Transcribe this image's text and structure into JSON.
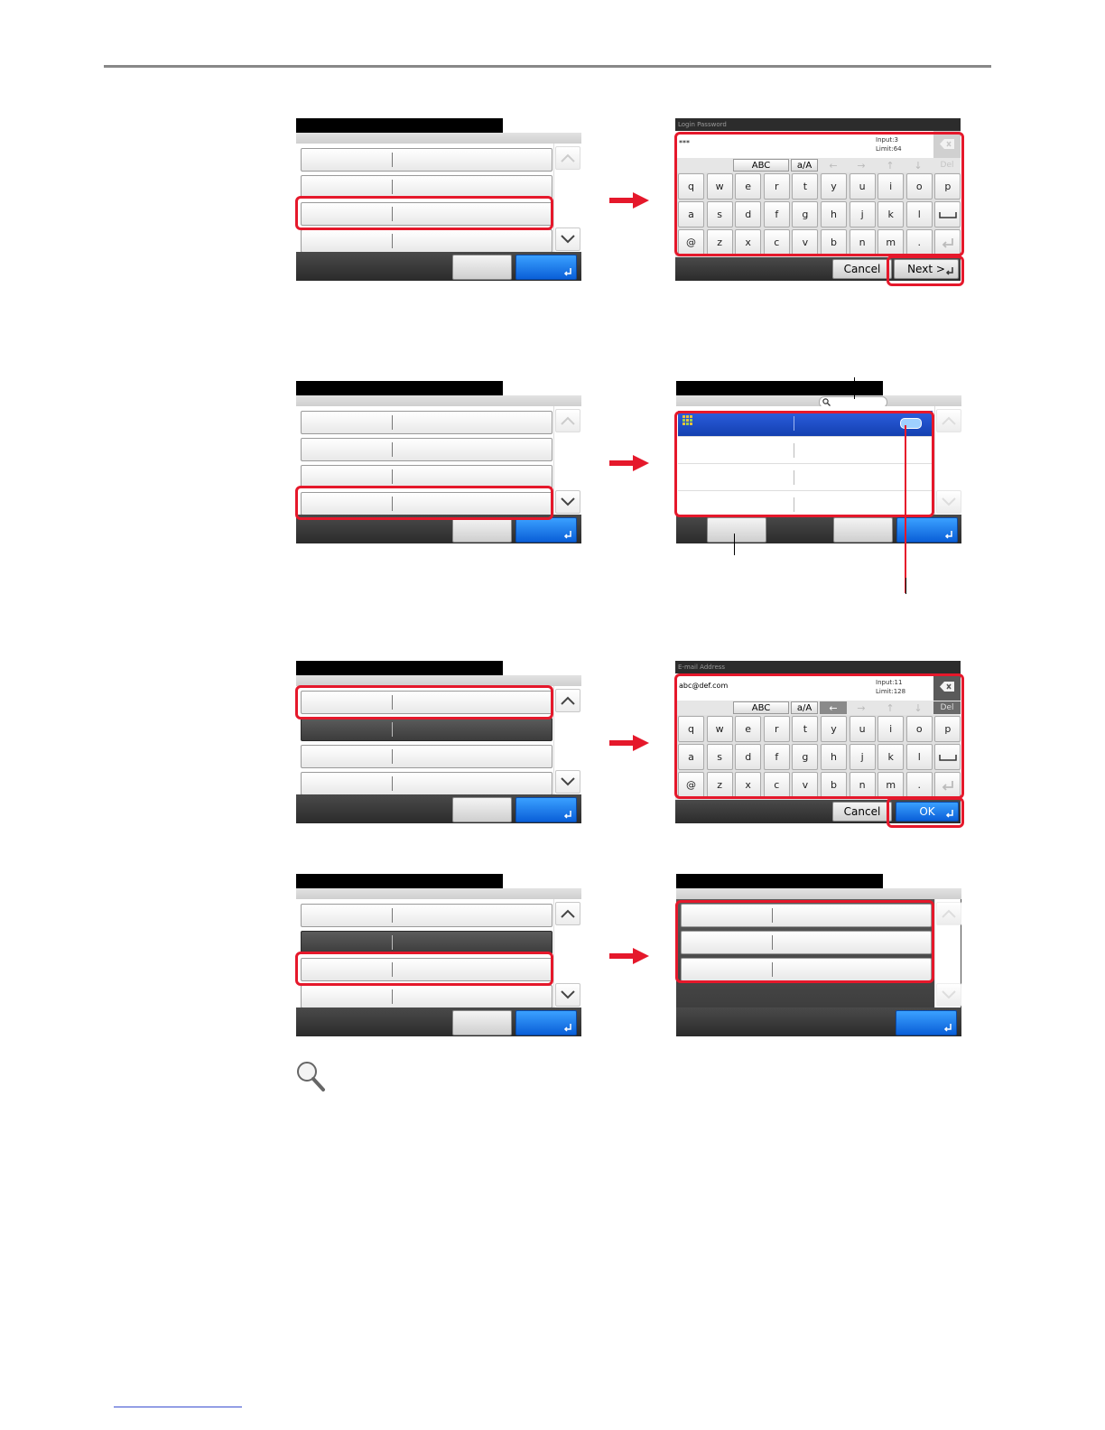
{
  "screens": {
    "password_keyboard": {
      "title": "Login Password",
      "input_value": "***",
      "input_count": "Input:3",
      "limit": "Limit:64",
      "ctrl_abc": "ABC",
      "ctrl_case": "a/A",
      "del_label": "Del",
      "row1": [
        "q",
        "w",
        "e",
        "r",
        "t",
        "y",
        "u",
        "i",
        "o",
        "p"
      ],
      "row2": [
        "a",
        "s",
        "d",
        "f",
        "g",
        "h",
        "j",
        "k",
        "l"
      ],
      "row3": [
        "@",
        "z",
        "x",
        "c",
        "v",
        "b",
        "n",
        "m",
        "."
      ],
      "cancel_label": "Cancel",
      "next_label": "Next >"
    },
    "email_keyboard": {
      "title": "E-mail Address",
      "input_value": "abc@def.com",
      "input_count": "Input:11",
      "limit": "Limit:128",
      "ctrl_abc": "ABC",
      "ctrl_case": "a/A",
      "del_label": "Del",
      "row1": [
        "q",
        "w",
        "e",
        "r",
        "t",
        "y",
        "u",
        "i",
        "o",
        "p"
      ],
      "row2": [
        "a",
        "s",
        "d",
        "f",
        "g",
        "h",
        "j",
        "k",
        "l"
      ],
      "row3": [
        "@",
        "z",
        "x",
        "c",
        "v",
        "b",
        "n",
        "m",
        "."
      ],
      "cancel_label": "Cancel",
      "ok_label": "OK"
    }
  },
  "icons": {
    "arrow": "right-arrow-icon",
    "magnifier": "magnifier-icon",
    "enter": "enter-icon",
    "backspace": "backspace-icon"
  },
  "colors": {
    "highlight": "#e5182b",
    "accent_blue": "#0a5fd8"
  }
}
